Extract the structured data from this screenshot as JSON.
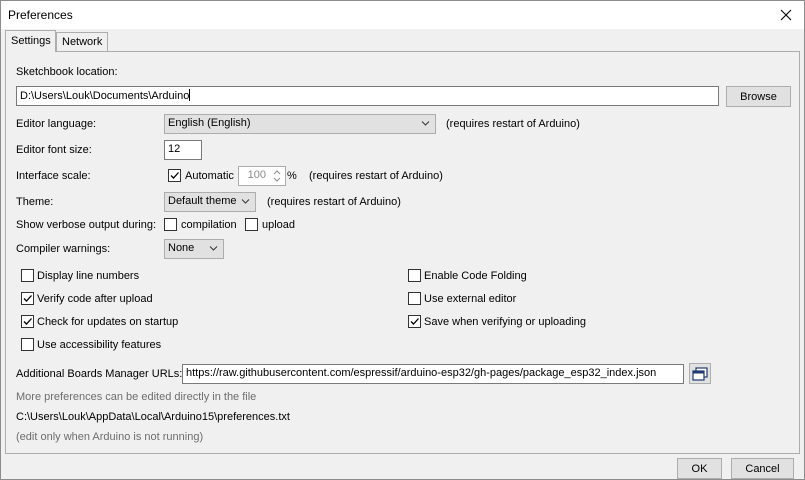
{
  "window": {
    "title": "Preferences"
  },
  "tabs": [
    {
      "label": "Settings",
      "active": true
    },
    {
      "label": "Network",
      "active": false
    }
  ],
  "settings": {
    "sketchbook_label": "Sketchbook location:",
    "sketchbook_value": "D:\\Users\\Louk\\Documents\\Arduino",
    "browse_label": "Browse",
    "language_label": "Editor language:",
    "language_value": "English (English)",
    "language_note": "(requires restart of Arduino)",
    "font_size_label": "Editor font size:",
    "font_size_value": "12",
    "scale_label": "Interface scale:",
    "scale_automatic_label": "Automatic",
    "scale_automatic_checked": true,
    "scale_value": "100",
    "scale_unit": "%",
    "scale_note": "(requires restart of Arduino)",
    "theme_label": "Theme:",
    "theme_value": "Default theme",
    "theme_note": "(requires restart of Arduino)",
    "verbose_label": "Show verbose output during:",
    "verbose_compilation_label": "compilation",
    "verbose_compilation_checked": false,
    "verbose_upload_label": "upload",
    "verbose_upload_checked": false,
    "warnings_label": "Compiler warnings:",
    "warnings_value": "None",
    "options_left": [
      {
        "label": "Display line numbers",
        "checked": false
      },
      {
        "label": "Verify code after upload",
        "checked": true
      },
      {
        "label": "Check for updates on startup",
        "checked": true
      },
      {
        "label": "Use accessibility features",
        "checked": false
      }
    ],
    "options_right": [
      {
        "label": "Enable Code Folding",
        "checked": false
      },
      {
        "label": "Use external editor",
        "checked": false
      },
      {
        "label": "Save when verifying or uploading",
        "checked": true
      }
    ],
    "boards_url_label": "Additional Boards Manager URLs:",
    "boards_url_value": "https://raw.githubusercontent.com/espressif/arduino-esp32/gh-pages/package_esp32_index.json",
    "more_prefs_note": "More preferences can be edited directly in the file",
    "prefs_path": "C:\\Users\\Louk\\AppData\\Local\\Arduino15\\preferences.txt",
    "edit_note": "(edit only when Arduino is not running)"
  },
  "footer": {
    "ok_label": "OK",
    "cancel_label": "Cancel"
  },
  "icons": {
    "close": "close-icon",
    "dropdown": "chevron-down-icon",
    "window_list": "open-list-icon"
  }
}
